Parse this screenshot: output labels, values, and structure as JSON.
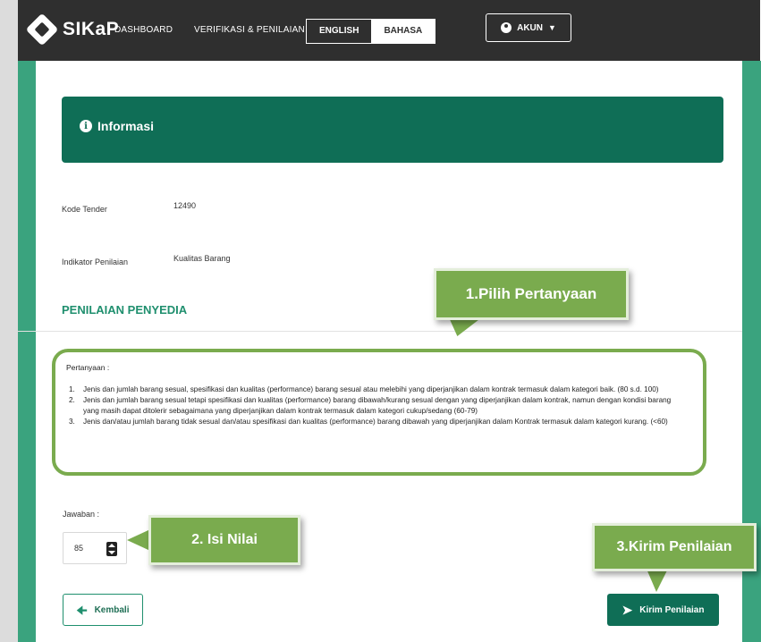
{
  "navbar": {
    "brand": "SIKaP",
    "links": [
      "DASHBOARD",
      "VERIFIKASI & PENILAIAN"
    ],
    "languages": [
      "ENGLISH",
      "BAHASA"
    ],
    "active_language": "BAHASA",
    "account_label": "AKUN"
  },
  "info_banner": {
    "title": "Informasi"
  },
  "fields": {
    "kode_tender_label": "Kode Tender",
    "kode_tender_value": "12490",
    "indikator_label": "Indikator Penilaian",
    "indikator_value": "Kualitas Barang"
  },
  "section_title": "PENILAIAN PENYEDIA",
  "question": {
    "label": "Pertanyaan :",
    "items": [
      "Jenis dan jumlah  barang sesual, spesifikasi dan kualitas (performance) barang sesual atau melebihi yang  diperjanjikan dalam kontrak termasuk dalam kategori baik. (80 s.d. 100)",
      "Jenis dan jumlah barang sesual tetapi spesifikasi dan kualitas (performance) barang dibawah/kurang sesual dengan yang diperjanjikan dalam kontrak, namun dengan kondisi barang yang masih dapat ditolerir sebagaimana yang diperjanjikan dalam kontrak termasuk dalam kategori cukup/sedang (60-79)",
      "Jenis dan/atau jumlah barang tidak sesual dan/atau spesifikasi dan kualitas (performance) barang dibawah yang diperjanjikan dalam Kontrak termasuk dalam kategori kurang. (<60)"
    ],
    "numbers": [
      "1.",
      "2.",
      "3."
    ]
  },
  "answer": {
    "label": "Jawaban :",
    "value": "85"
  },
  "buttons": {
    "back": "Kembali",
    "submit": "Kirim Penilaian"
  },
  "callouts": {
    "step1": "1.Pilih Pertanyaan",
    "step2": "2. Isi Nilai",
    "step3": "3.Kirim Penilaian"
  },
  "icons": {
    "info": "info-icon",
    "user": "user-icon",
    "back": "arrow-left-icon",
    "send": "send-icon"
  },
  "colors": {
    "primary": "#0f6e56",
    "accent": "#1f8f6e",
    "callout": "#7aab4e",
    "navbar": "#2f2f2f"
  }
}
